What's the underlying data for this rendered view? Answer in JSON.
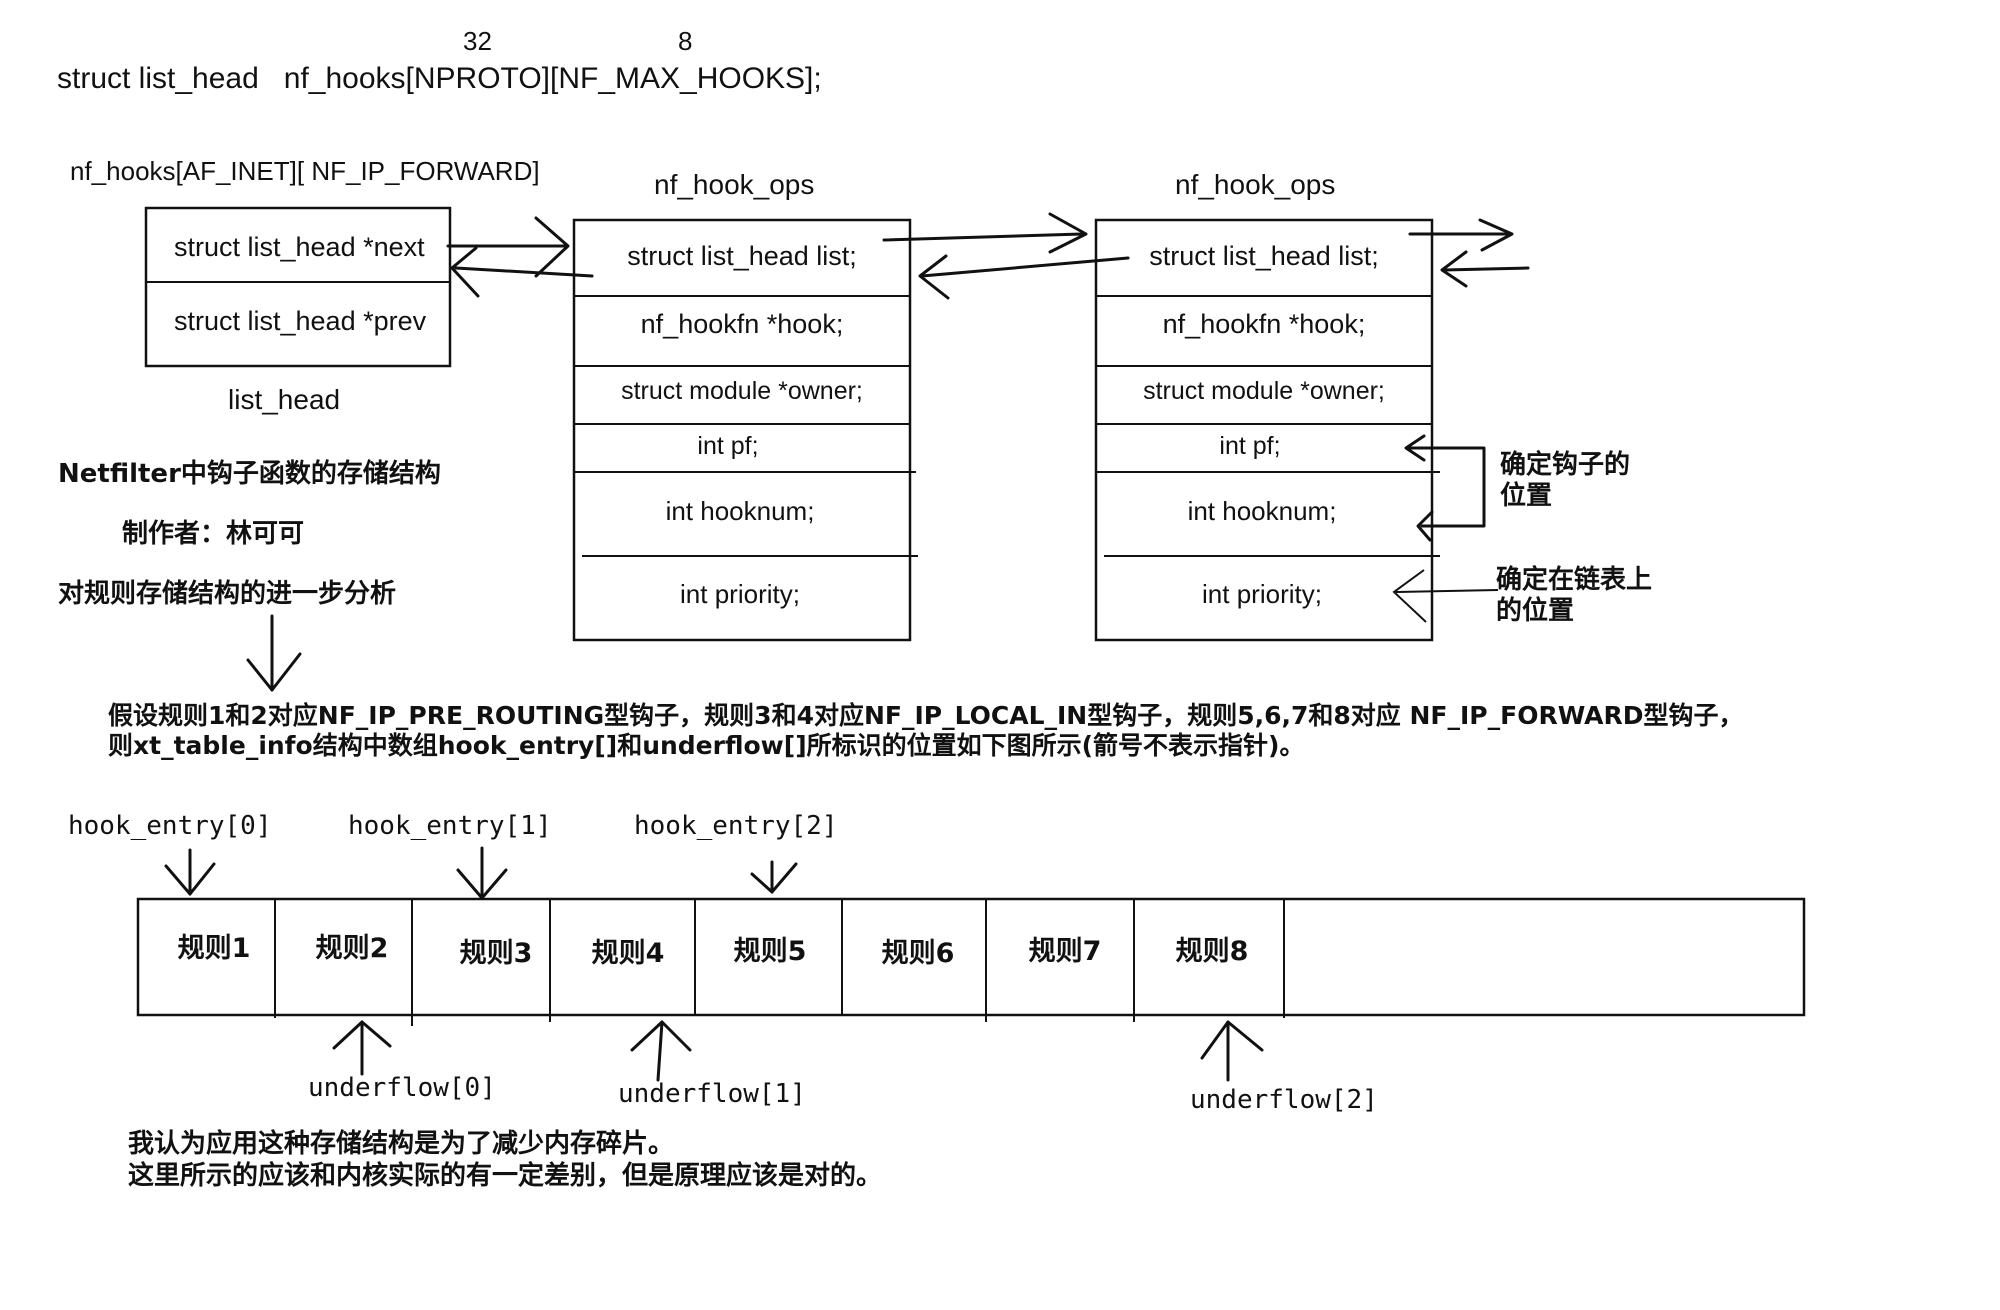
{
  "header": {
    "dim_nproto": "32",
    "dim_max_hooks": "8",
    "declaration": "struct list_head   nf_hooks[NPROTO][NF_MAX_HOOKS];"
  },
  "list_head_node": {
    "array_label": "nf_hooks[AF_INET][ NF_IP_FORWARD]",
    "fields": [
      "struct list_head *next",
      "struct list_head *prev"
    ],
    "caption": "list_head"
  },
  "hook_ops_nodes": [
    {
      "title": "nf_hook_ops",
      "fields": [
        "struct list_head list;",
        "nf_hookfn *hook;",
        "struct module *owner;",
        "int pf;",
        "int hooknum;",
        "int priority;"
      ]
    },
    {
      "title": "nf_hook_ops",
      "fields": [
        "struct list_head list;",
        "nf_hookfn *hook;",
        "struct module *owner;",
        "int pf;",
        "int hooknum;",
        "int priority;"
      ]
    }
  ],
  "side_notes": {
    "hook_position": [
      "确定钩子的",
      "位置"
    ],
    "list_position": [
      "确定在链表上",
      "的位置"
    ]
  },
  "left_notes": {
    "title": "Netfilter中钩子函数的存储结构",
    "author": "制作者：林可可",
    "analysis": "对规则存储结构的进一步分析"
  },
  "assumption": [
    "假设规则1和2对应NF_IP_PRE_ROUTING型钩子，规则3和4对应NF_IP_LOCAL_IN型钩子，规则5,6,7和8对应 NF_IP_FORWARD型钩子，",
    "则xt_table_info结构中数组hook_entry[]和underflow[]所标识的位置如下图所示(箭号不表示指针)。"
  ],
  "rules": [
    "规则1",
    "规则2",
    "规则3",
    "规则4",
    "规则5",
    "规则6",
    "规则7",
    "规则8"
  ],
  "hook_entries": [
    "hook_entry[0]",
    "hook_entry[1]",
    "hook_entry[2]"
  ],
  "underflows": [
    "underflow[0]",
    "underflow[1]",
    "underflow[2]"
  ],
  "conclusion": [
    "我认为应用这种存储结构是为了减少内存碎片。",
    "这里所示的应该和内核实际的有一定差别，但是原理应该是对的。"
  ]
}
